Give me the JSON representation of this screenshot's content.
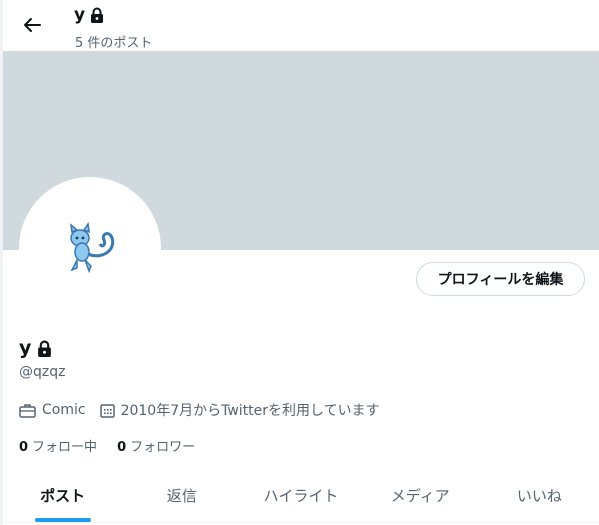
{
  "header": {
    "name": "y",
    "post_count": "5 件のポスト"
  },
  "profile": {
    "edit_button": "プロフィールを編集",
    "display_name": "y",
    "handle": "@qzqz",
    "category": "Comic",
    "joined": "2010年7月からTwitterを利用しています",
    "following_count": "0",
    "following_label": "フォロー中",
    "followers_count": "0",
    "followers_label": "フォロワー"
  },
  "tabs": [
    {
      "label": "ポスト"
    },
    {
      "label": "返信"
    },
    {
      "label": "ハイライト"
    },
    {
      "label": "メディア"
    },
    {
      "label": "いいね"
    }
  ],
  "icons": {
    "back": "arrow-left-icon",
    "lock": "lock-icon",
    "briefcase": "briefcase-icon",
    "calendar": "calendar-icon"
  },
  "colors": {
    "accent": "#1d9bf0",
    "banner": "#cfd9de",
    "secondary_text": "#536471"
  }
}
